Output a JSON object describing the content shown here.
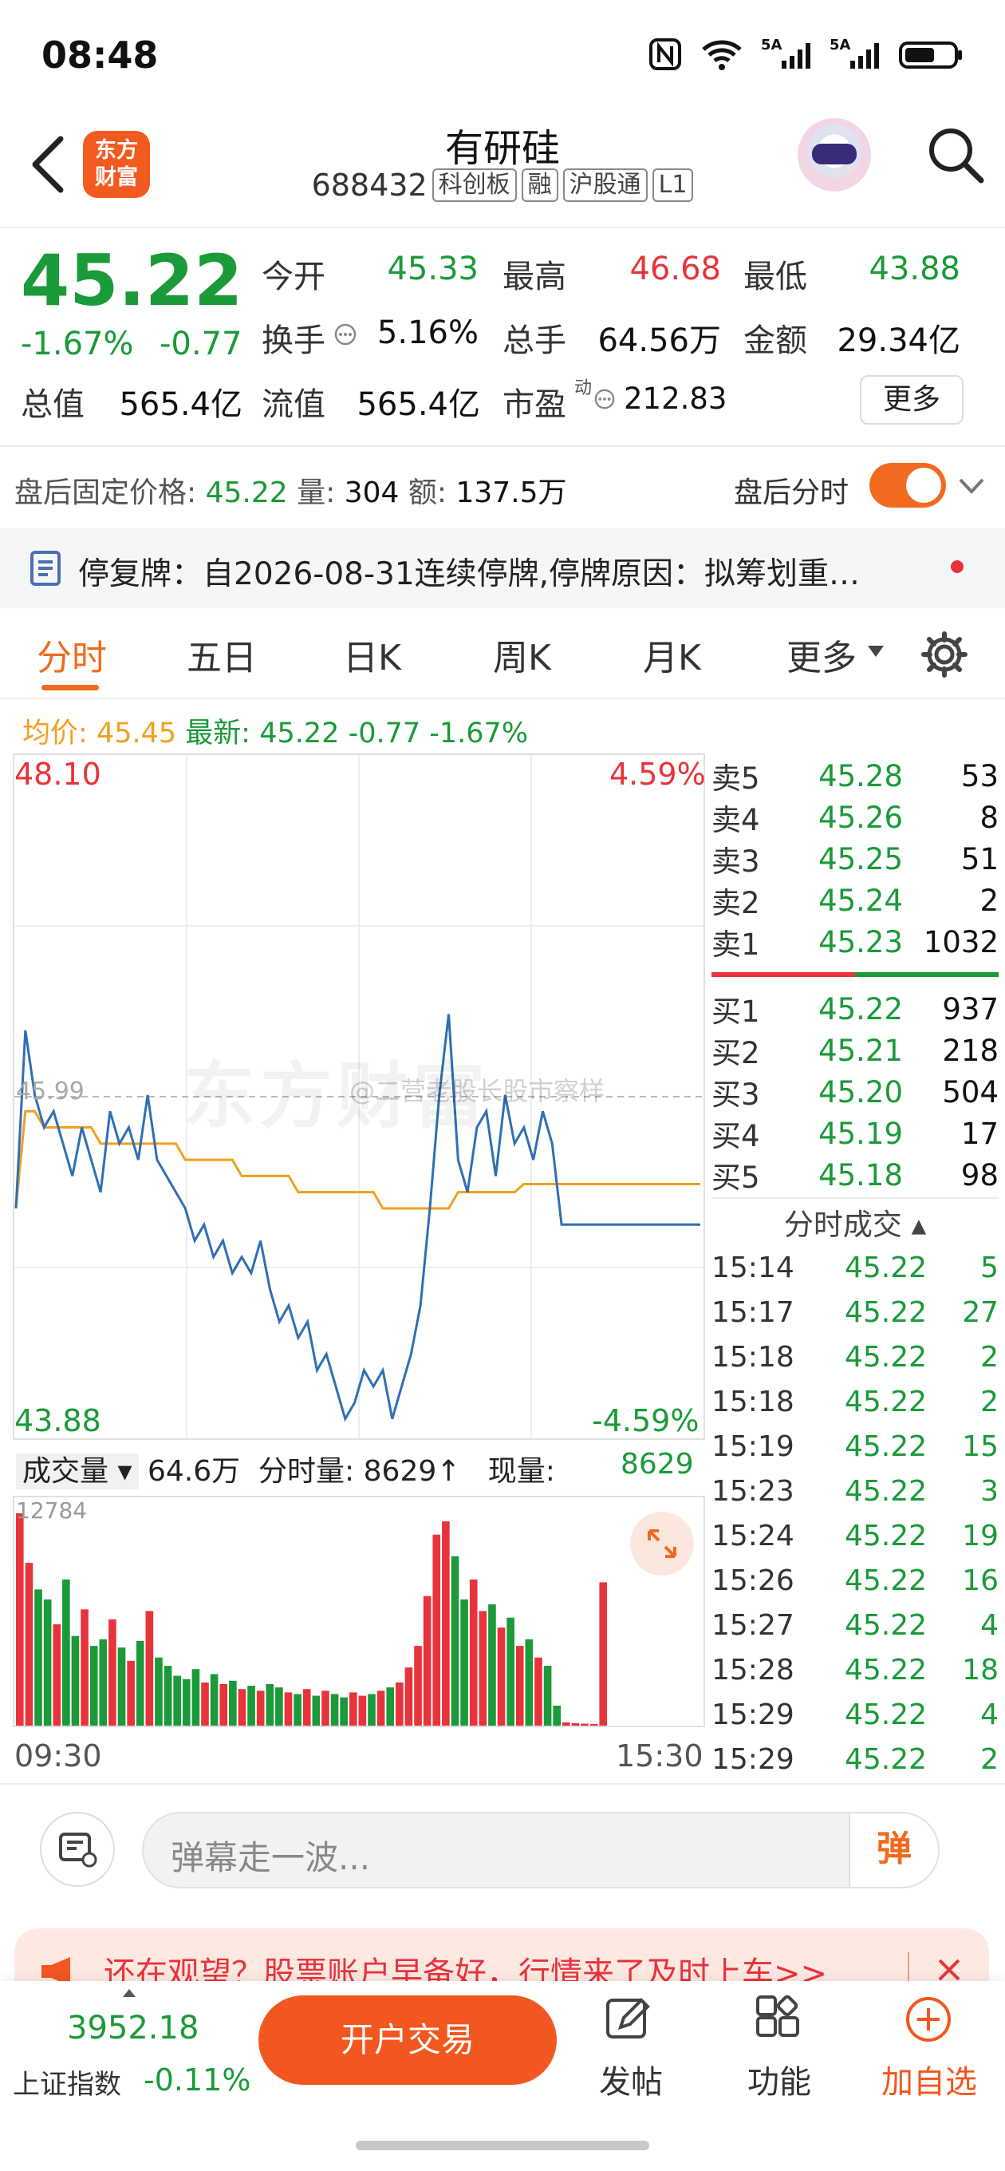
{
  "status": {
    "time": "08:48",
    "net1": "5A",
    "net2": "5A"
  },
  "header": {
    "logo_line1": "东方",
    "logo_line2": "财富",
    "name": "有研硅",
    "code": "688432",
    "tags": [
      "科创板",
      "融",
      "沪股通",
      "L1"
    ]
  },
  "quote": {
    "price": "45.22",
    "change_pct": "-1.67%",
    "change_abs": "-0.77",
    "open_label": "今开",
    "open": "45.33",
    "high_label": "最高",
    "high": "46.68",
    "low_label": "最低",
    "low": "43.88",
    "turnover_label": "换手",
    "turnover": "5.16%",
    "volume_label": "总手",
    "volume": "64.56万",
    "amount_label": "金额",
    "amount": "29.34亿",
    "mcap_label": "总值",
    "mcap": "565.4亿",
    "float_label": "流值",
    "float": "565.4亿",
    "pe_label": "市盈",
    "pe_sup": "动",
    "pe": "212.83",
    "more": "更多"
  },
  "after_hours": {
    "label": "盘后固定价格:",
    "price": "45.22",
    "vol_label": "量:",
    "vol": "304",
    "amt_label": "额:",
    "amt": "137.5万",
    "toggle_label": "盘后分时"
  },
  "notice": {
    "text": "停复牌：自2026-08-31连续停牌,停牌原因：拟筹划重…"
  },
  "tabs": [
    "分时",
    "五日",
    "日K",
    "周K",
    "月K",
    "更多"
  ],
  "avg_row": {
    "avg_label": "均价:",
    "avg": "45.45",
    "latest_label": "最新:",
    "latest": "45.22",
    "chg": "-0.77",
    "pct": "-1.67%"
  },
  "chart_labels": {
    "top_price": "48.10",
    "top_pct": "4.59%",
    "mid_price": "45.99",
    "bottom_price": "43.88",
    "bottom_pct": "-4.59%",
    "watermark": "东方财富",
    "weibo": "@二营老股长股市察样",
    "vol_selector": "成交量",
    "vol_total": "64.6万",
    "vol_min_label": "分时量:",
    "vol_min": "8629↑",
    "vol_now_label": "现量:",
    "vol_now": "8629",
    "vol_max": "12784",
    "time_start": "09:30",
    "time_end": "15:30"
  },
  "order_book": {
    "asks": [
      {
        "label": "卖5",
        "price": "45.28",
        "qty": "53"
      },
      {
        "label": "卖4",
        "price": "45.26",
        "qty": "8"
      },
      {
        "label": "卖3",
        "price": "45.25",
        "qty": "51"
      },
      {
        "label": "卖2",
        "price": "45.24",
        "qty": "2"
      },
      {
        "label": "卖1",
        "price": "45.23",
        "qty": "1032"
      }
    ],
    "bids": [
      {
        "label": "买1",
        "price": "45.22",
        "qty": "937"
      },
      {
        "label": "买2",
        "price": "45.21",
        "qty": "218"
      },
      {
        "label": "买3",
        "price": "45.20",
        "qty": "504"
      },
      {
        "label": "买4",
        "price": "45.19",
        "qty": "17"
      },
      {
        "label": "买5",
        "price": "45.18",
        "qty": "98"
      }
    ],
    "ticks_title": "分时成交 ▴",
    "ticks": [
      {
        "time": "15:14",
        "price": "45.22",
        "qty": "5"
      },
      {
        "time": "15:17",
        "price": "45.22",
        "qty": "27"
      },
      {
        "time": "15:18",
        "price": "45.22",
        "qty": "2"
      },
      {
        "time": "15:18",
        "price": "45.22",
        "qty": "2"
      },
      {
        "time": "15:19",
        "price": "45.22",
        "qty": "15"
      },
      {
        "time": "15:23",
        "price": "45.22",
        "qty": "3"
      },
      {
        "time": "15:24",
        "price": "45.22",
        "qty": "19"
      },
      {
        "time": "15:26",
        "price": "45.22",
        "qty": "16"
      },
      {
        "time": "15:27",
        "price": "45.22",
        "qty": "4"
      },
      {
        "time": "15:28",
        "price": "45.22",
        "qty": "18"
      },
      {
        "time": "15:29",
        "price": "45.22",
        "qty": "4"
      },
      {
        "time": "15:29",
        "price": "45.22",
        "qty": "2"
      }
    ]
  },
  "danmaku": {
    "placeholder": "弹幕走一波...",
    "button": "弹"
  },
  "promo": {
    "text": "还在观望？股票账户早备好，行情来了及时上车>>"
  },
  "bottom": {
    "index_value": "3952.18",
    "index_name": "上证指数",
    "index_chg": "-0.11%",
    "trade": "开户交易",
    "post": "发帖",
    "func": "功能",
    "watch": "加自选"
  },
  "colors": {
    "up": "#e8333b",
    "down": "#1a9a38",
    "accent": "#f26a1f",
    "price_line": "#2f6fb3",
    "avg_line": "#f0a020"
  },
  "chart_data": {
    "type": "line",
    "x_range": [
      "09:30",
      "15:30"
    ],
    "ylim": [
      43.88,
      48.1
    ],
    "series": [],
    "price": [
      45.3,
      46.4,
      46.0,
      45.8,
      45.9,
      45.7,
      45.5,
      45.8,
      45.6,
      45.4,
      45.9,
      45.7,
      45.8,
      45.6,
      46.0,
      45.6,
      45.5,
      45.4,
      45.3,
      45.1,
      45.2,
      45.0,
      45.1,
      44.9,
      45.0,
      44.9,
      45.1,
      44.8,
      44.6,
      44.7,
      44.5,
      44.6,
      44.3,
      44.4,
      44.2,
      44.0,
      44.1,
      44.3,
      44.2,
      44.3,
      44.0,
      44.2,
      44.4,
      44.7,
      45.3,
      46.0,
      46.5,
      45.6,
      45.4,
      45.8,
      45.9,
      45.5,
      46.0,
      45.7,
      45.8,
      45.6,
      45.9,
      45.7,
      45.2,
      45.2,
      45.2,
      45.2,
      45.2,
      45.2
    ],
    "avg": [
      45.3,
      45.9,
      45.9,
      45.8,
      45.8,
      45.8,
      45.8,
      45.8,
      45.8,
      45.7,
      45.7,
      45.7,
      45.7,
      45.7,
      45.7,
      45.7,
      45.7,
      45.7,
      45.6,
      45.6,
      45.6,
      45.6,
      45.6,
      45.6,
      45.5,
      45.5,
      45.5,
      45.5,
      45.5,
      45.5,
      45.4,
      45.4,
      45.4,
      45.4,
      45.4,
      45.4,
      45.4,
      45.4,
      45.4,
      45.3,
      45.3,
      45.3,
      45.3,
      45.3,
      45.3,
      45.3,
      45.3,
      45.4,
      45.4,
      45.4,
      45.4,
      45.4,
      45.4,
      45.4,
      45.45,
      45.45,
      45.45,
      45.45,
      45.45,
      45.45,
      45.45,
      45.45,
      45.45,
      45.45
    ],
    "volume": [
      12784,
      9800,
      8200,
      7600,
      6100,
      8800,
      5400,
      7000,
      4800,
      5200,
      6400,
      4700,
      3900,
      5100,
      6900,
      4100,
      3600,
      3000,
      2800,
      3400,
      2600,
      3100,
      2500,
      2700,
      2200,
      2400,
      2100,
      2500,
      2300,
      2000,
      1900,
      2200,
      1800,
      2100,
      1900,
      1700,
      2000,
      1800,
      1900,
      2100,
      2300,
      2600,
      3500,
      4800,
      7800,
      11500,
      12300,
      10200,
      7600,
      8800,
      6900,
      7300,
      5900,
      6500,
      4800,
      5200,
      4100,
      3600,
      1200,
      200,
      150,
      120,
      100,
      8629
    ]
  }
}
